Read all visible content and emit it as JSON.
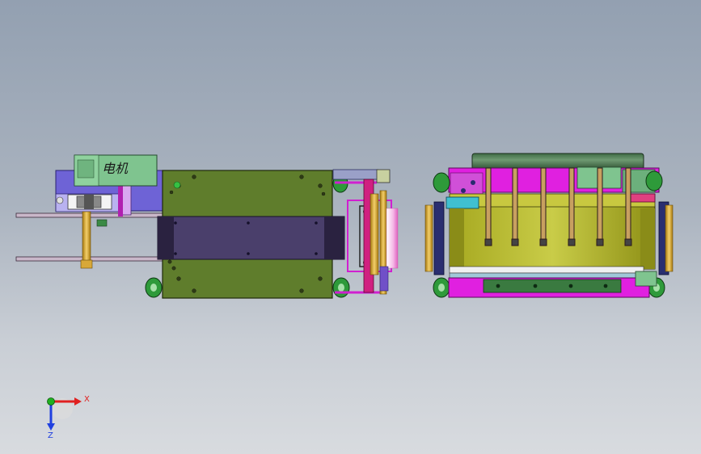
{
  "window": {
    "title": ""
  },
  "colors": {
    "background_top": "#93a0b1",
    "background_bottom": "#d8dbdf",
    "frame_green": "#5f7d2c",
    "belt_purple": "#4a3f6b",
    "magenta": "#e020e0",
    "bearing_yellow": "#e0b040",
    "wheel_green": "#2e9a3a",
    "motor_cover": "#7fc48f",
    "gearbox_blue": "#6e63d6",
    "axis_x": "#e02020",
    "axis_y": "#20b020",
    "axis_z": "#2040e0"
  },
  "model": {
    "motor_label": "电机",
    "left_unit": "feed-conveyor",
    "right_unit": "cutter-assembly"
  },
  "triad": {
    "x_label": "X",
    "z_label": "Z"
  }
}
